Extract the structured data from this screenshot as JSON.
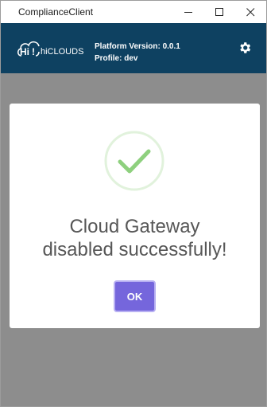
{
  "window": {
    "title": "ComplianceClient",
    "controls": [
      "minimize",
      "maximize",
      "close"
    ]
  },
  "header": {
    "logo_text": "hiCLOUDS",
    "platform_version": "Platform Version: 0.0.1",
    "profile": "Profile: dev",
    "settings_icon": "gear-icon",
    "background_color": "#0e4161"
  },
  "modal": {
    "icon": "check-circle-icon",
    "message_line1": "Cloud Gateway",
    "message_line2": "disabled successfully!",
    "ok_label": "OK",
    "accent_color": "#7566dc",
    "success_color": "#8ed07e"
  }
}
